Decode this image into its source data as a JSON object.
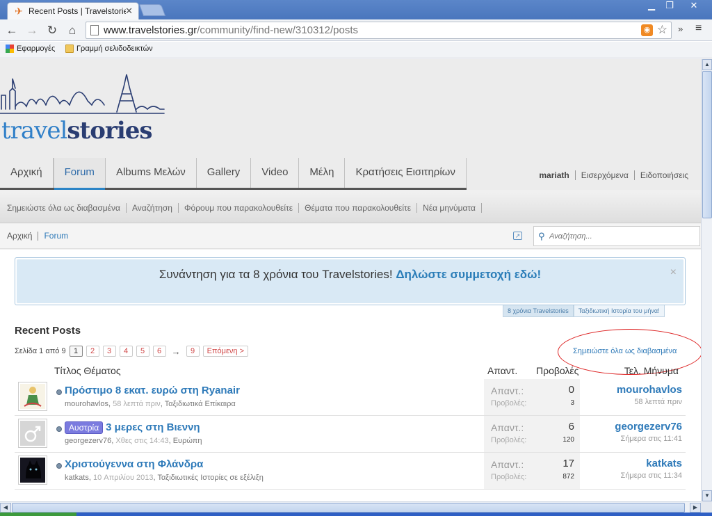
{
  "browser": {
    "tab_title": "Recent Posts | Travelstories",
    "url_host": "www.travelstories.gr",
    "url_path": "/community/find-new/310312/posts",
    "bookmarks": [
      "Εφαρμογές",
      "Γραμμή σελιδοδεικτών"
    ]
  },
  "logo": {
    "part1": "travel",
    "part2": "stories"
  },
  "main_nav": [
    "Αρχική",
    "Forum",
    "Albums Μελών",
    "Gallery",
    "Video",
    "Μέλη",
    "Κρατήσεις Εισιτηρίων"
  ],
  "main_nav_active": "Forum",
  "user_nav": [
    "mariath",
    "Εισερχόμενα",
    "Ειδοποιήσεις"
  ],
  "sub_nav": [
    "Σημειώστε όλα ως διαβασμένα",
    "Αναζήτηση",
    "Φόρουμ που παρακολουθείτε",
    "Θέματα που παρακολουθείτε",
    "Νέα μηνύματα"
  ],
  "breadcrumb": [
    "Αρχική",
    "Forum"
  ],
  "search": {
    "placeholder": "Αναζήτηση..."
  },
  "notice": {
    "text": "Συνάντηση για τα 8 χρόνια του Travelstories!",
    "link": "Δηλώστε συμμετοχή εδώ!",
    "close": "×",
    "tabs": [
      "8 χρόνια Travelstories",
      "Ταξιδιωτική Ιστορία του μήνα!"
    ]
  },
  "heading": "Recent Posts",
  "pager": {
    "label": "Σελίδα 1 από 9",
    "pages": [
      "1",
      "2",
      "3",
      "4",
      "5",
      "6"
    ],
    "arrow": "→",
    "last": "9",
    "next": "Επόμενη >"
  },
  "mark_read": "Σημειώστε όλα ως διαβασμένα",
  "columns": {
    "title": "Τίτλος Θέματος",
    "replies": "Απαντ.",
    "views": "Προβολές",
    "last": "Τελ. Μήνυμα"
  },
  "posts": [
    {
      "title": "Πρόστιμο 8 εκατ. ευρώ στη Ryanair",
      "prefix": "",
      "author": "mourohavlos",
      "time": "58 λεπτά πριν",
      "forum": "Ταξιδιωτικά Επίκαιρα",
      "replies_label": "Απαντ.:",
      "replies": "0",
      "views_label": "Προβολές:",
      "views": "3",
      "last_user": "mourohavlos",
      "last_time": "58 λεπτά πριν"
    },
    {
      "title": "3 μερες στη Βιεννη",
      "prefix": "Αυστρία",
      "author": "georgezerv76",
      "time": "Χθες στις 14:43",
      "forum": "Ευρώπη",
      "replies_label": "Απαντ.:",
      "replies": "6",
      "views_label": "Προβολές:",
      "views": "120",
      "last_user": "georgezerv76",
      "last_time": "Σήμερα στις 11:41"
    },
    {
      "title": "Χριστούγεννα στη Φλάνδρα",
      "prefix": "",
      "author": "katkats",
      "time": "10 Απριλίου 2013",
      "forum": "Ταξιδιωτικές Ιστορίες σε εξέλιξη",
      "replies_label": "Απαντ.:",
      "replies": "17",
      "views_label": "Προβολές:",
      "views": "872",
      "last_user": "katkats",
      "last_time": "Σήμερα στις 11:34"
    }
  ],
  "colors": {
    "link": "#2e7ab9",
    "accent": "#2b84c6",
    "pager_link": "#d04646",
    "annotation": "#dd2222"
  }
}
